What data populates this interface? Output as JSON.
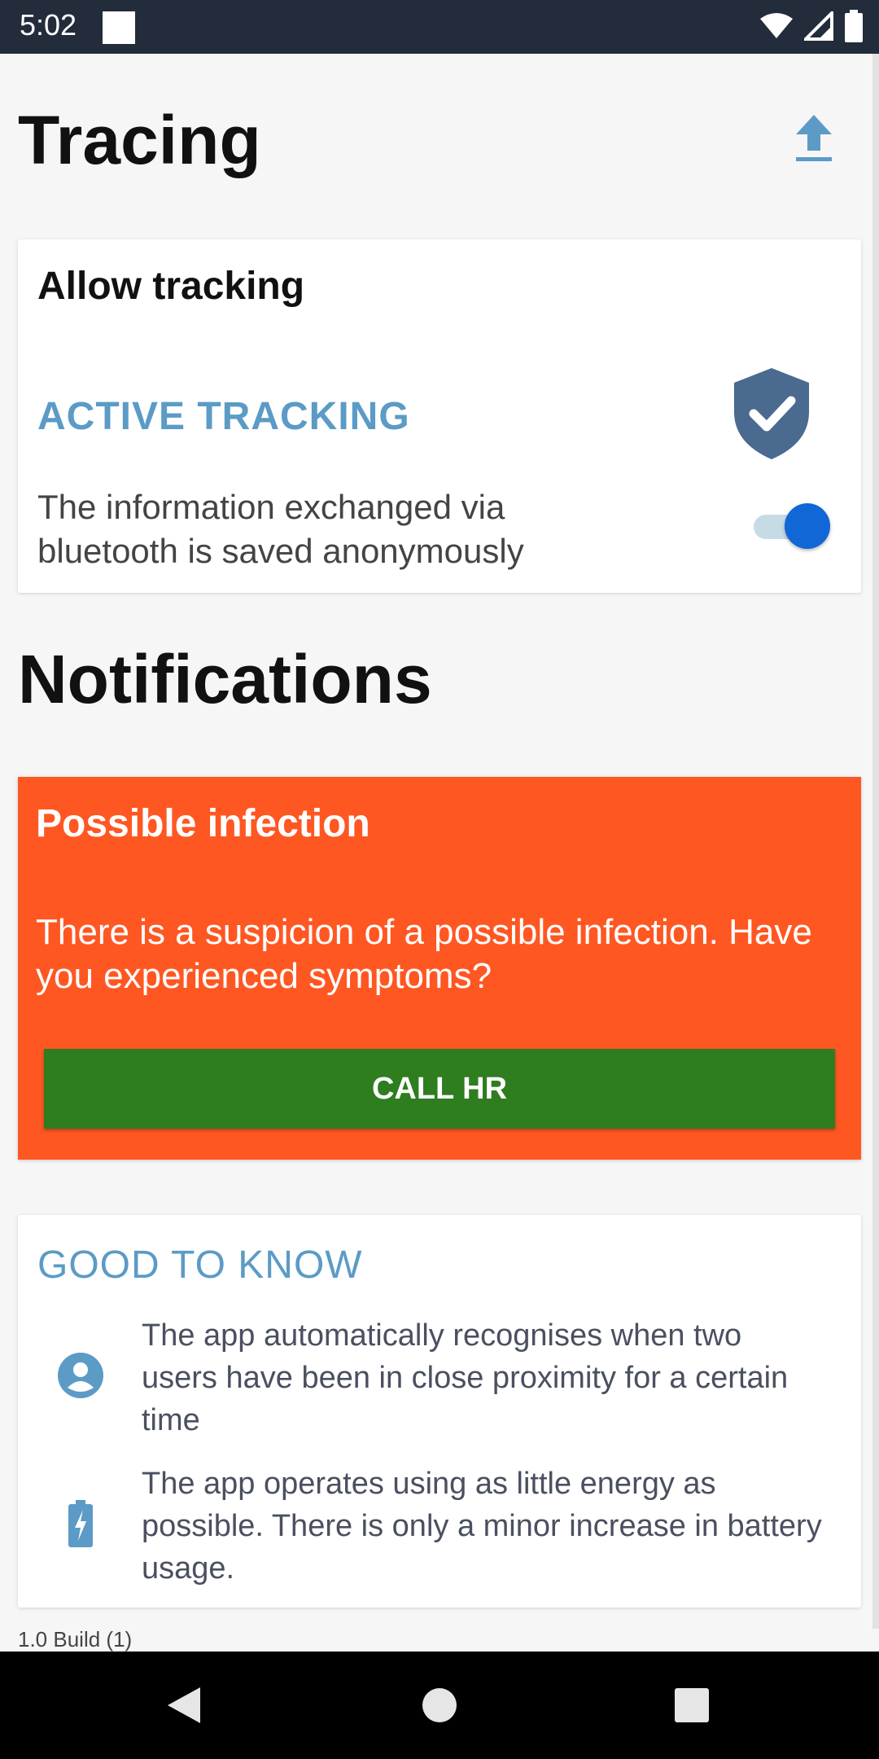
{
  "status_bar": {
    "time": "5:02"
  },
  "header": {
    "title": "Tracing"
  },
  "tracking_card": {
    "title": "Allow tracking",
    "status_label": "ACTIVE TRACKING",
    "description": "The information exchanged via bluetooth is saved anonymously",
    "toggle_on": true
  },
  "notifications": {
    "title": "Notifications",
    "card": {
      "title": "Possible infection",
      "message": "There is a suspicion of a possible infection. Have you experienced symptoms?",
      "button_label": "CALL HR"
    }
  },
  "good_to_know": {
    "title": "GOOD TO KNOW",
    "items": [
      {
        "icon": "user-circle-icon",
        "text": "The app automatically recognises when two users have been in close proximity for a certain time"
      },
      {
        "icon": "battery-charging-icon",
        "text": "The app operates using as little energy as possible. There is only a minor increase in battery usage."
      }
    ]
  },
  "footer": {
    "build": "1.0 Build (1)"
  },
  "colors": {
    "accent": "#5b9bc6",
    "alert": "#ff5722",
    "button": "#2e7d1f",
    "toggle": "#1167d6",
    "shield": "#4a6a8f"
  }
}
